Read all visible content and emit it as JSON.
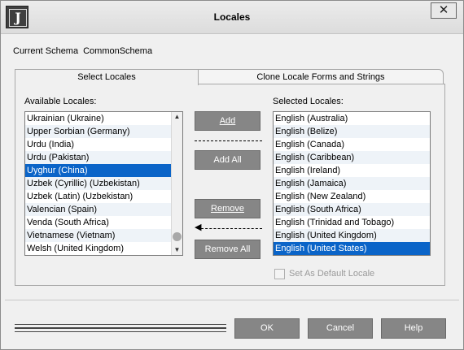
{
  "window": {
    "title": "Locales",
    "app_icon_letter": "J",
    "close_glyph": "✕"
  },
  "schema": {
    "label": "Current Schema",
    "value": "CommonSchema"
  },
  "tabs": [
    {
      "label": "Select Locales",
      "active": true
    },
    {
      "label": "Clone Locale Forms and Strings",
      "active": false
    }
  ],
  "available": {
    "label": "Available Locales:",
    "items": [
      "Ukrainian (Ukraine)",
      "Upper Sorbian (Germany)",
      "Urdu (India)",
      "Urdu (Pakistan)",
      "Uyghur (China)",
      "Uzbek (Cyrillic) (Uzbekistan)",
      "Uzbek (Latin) (Uzbekistan)",
      "Valencian (Spain)",
      "Venda (South Africa)",
      "Vietnamese (Vietnam)",
      "Welsh (United Kingdom)"
    ],
    "selected": "Uyghur (China)"
  },
  "selected_locales": {
    "label": "Selected Locales:",
    "items": [
      "English (Australia)",
      "English (Belize)",
      "English (Canada)",
      "English (Caribbean)",
      "English (Ireland)",
      "English (Jamaica)",
      "English (New Zealand)",
      "English (South Africa)",
      "English (Trinidad and Tobago)",
      "English (United Kingdom)",
      "English (United States)"
    ],
    "selected": "English (United States)"
  },
  "buttons": {
    "add": "Add",
    "add_all": "Add All",
    "remove": "Remove",
    "remove_all": "Remove All",
    "ok": "OK",
    "cancel": "Cancel",
    "help": "Help"
  },
  "default_locale": {
    "label": "Set As Default Locale",
    "checked": false,
    "enabled": false
  },
  "colors": {
    "button_bg": "#868686",
    "selection": "#0a64c8",
    "title_bar": "#e4e4e4"
  }
}
